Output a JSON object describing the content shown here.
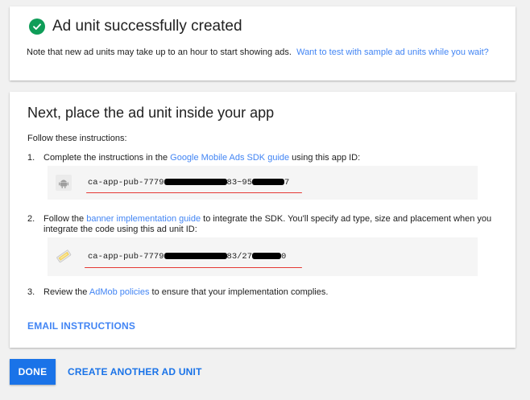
{
  "success": {
    "title": "Ad unit successfully created",
    "note": "Note that new ad units may take up to an hour to start showing ads.",
    "note_link": "Want to test with sample ad units while you wait?"
  },
  "next": {
    "title": "Next, place the ad unit inside your app",
    "follow": "Follow these instructions:",
    "step1": {
      "num": "1.",
      "pre": "Complete the instructions in the ",
      "link": "Google Mobile Ads SDK guide",
      "post": " using this app ID:",
      "id_prefix": "ca-app-pub-7779",
      "id_mid": "83~95",
      "id_suffix": "7",
      "icon": "android-icon"
    },
    "step2": {
      "num": "2.",
      "pre": "Follow the ",
      "link": "banner implementation guide",
      "post": " to integrate the SDK. You'll specify ad type, size and placement when you integrate the code using this ad unit ID:",
      "id_prefix": "ca-app-pub-7779",
      "id_mid": "83/27",
      "id_suffix": "0",
      "icon": "ad-unit-icon"
    },
    "step3": {
      "num": "3.",
      "pre": "Review the ",
      "link": "AdMob policies",
      "post": " to ensure that your implementation complies."
    },
    "email_label": "EMAIL INSTRUCTIONS"
  },
  "actions": {
    "done_label": "DONE",
    "create_label": "CREATE ANOTHER AD UNIT"
  },
  "colors": {
    "success_green": "#0f9d58",
    "link_blue": "#4285f4",
    "primary_blue": "#1a73e8",
    "annotation_red": "#e53935"
  }
}
